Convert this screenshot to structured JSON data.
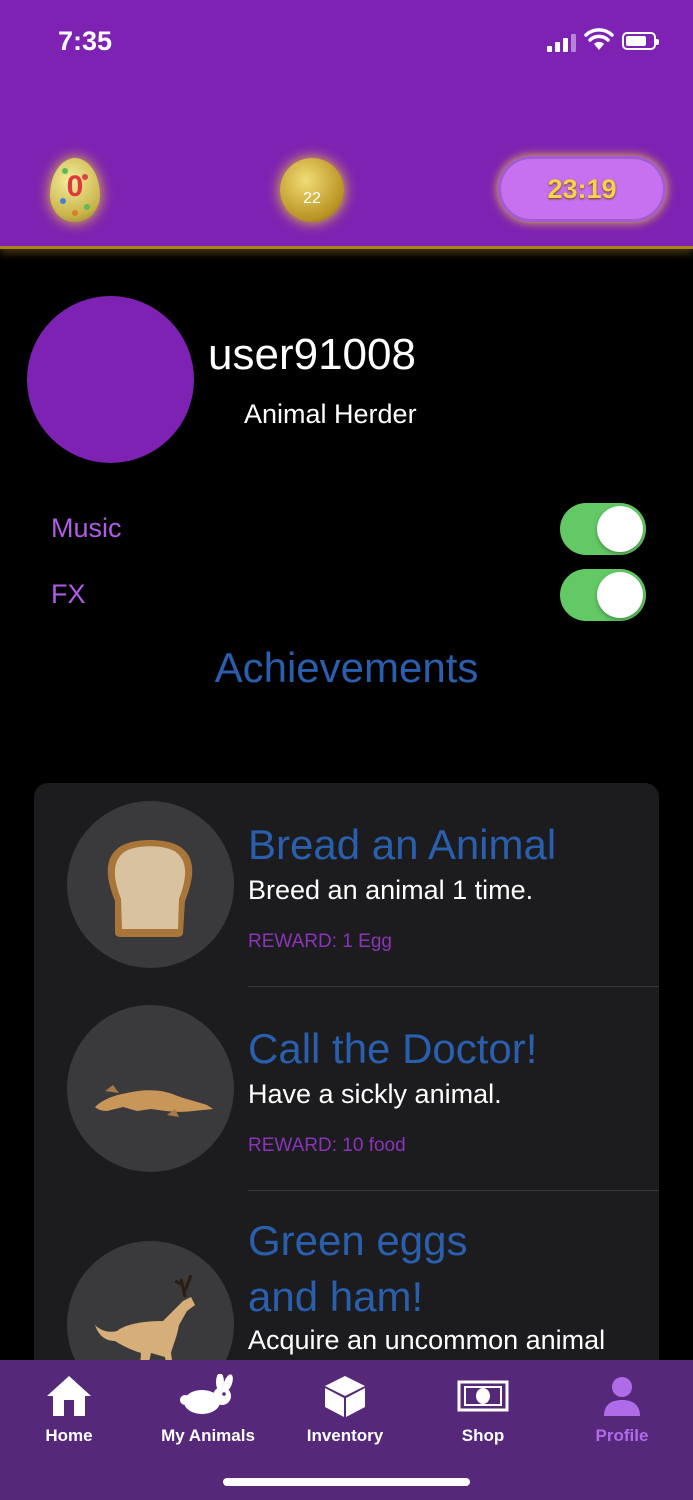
{
  "status_bar": {
    "time": "7:35"
  },
  "header": {
    "eggs_count": "0",
    "coins_count": "22",
    "timer": "23:19"
  },
  "profile": {
    "username": "user91008",
    "rank": "Animal Herder"
  },
  "settings": [
    {
      "label": "Music",
      "enabled": true
    },
    {
      "label": "FX",
      "enabled": true
    }
  ],
  "achievements": {
    "title": "Achievements",
    "items": [
      {
        "name": "Bread an Animal",
        "description": "Breed an animal 1 time.",
        "reward": "REWARD: 1 Egg",
        "icon": "bread-icon"
      },
      {
        "name": "Call the Doctor!",
        "description": "Have a sickly animal.",
        "reward": "REWARD: 10 food",
        "icon": "sick-animal-icon"
      },
      {
        "name_line1": "Green eggs",
        "name_line2": "and ham!",
        "description": "Acquire an uncommon animal",
        "icon": "antlered-animal-icon"
      }
    ]
  },
  "tabbar": {
    "tabs": [
      {
        "label": "Home",
        "icon": "home-icon"
      },
      {
        "label": "My Animals",
        "icon": "rabbit-icon"
      },
      {
        "label": "Inventory",
        "icon": "box-icon"
      },
      {
        "label": "Shop",
        "icon": "money-icon"
      },
      {
        "label": "Profile",
        "icon": "person-icon",
        "active": true
      }
    ]
  },
  "colors": {
    "header": "#7d22b2",
    "accent_blue": "#2a5fae",
    "toggle_on": "#63c964",
    "tabbar": "#56287a"
  }
}
